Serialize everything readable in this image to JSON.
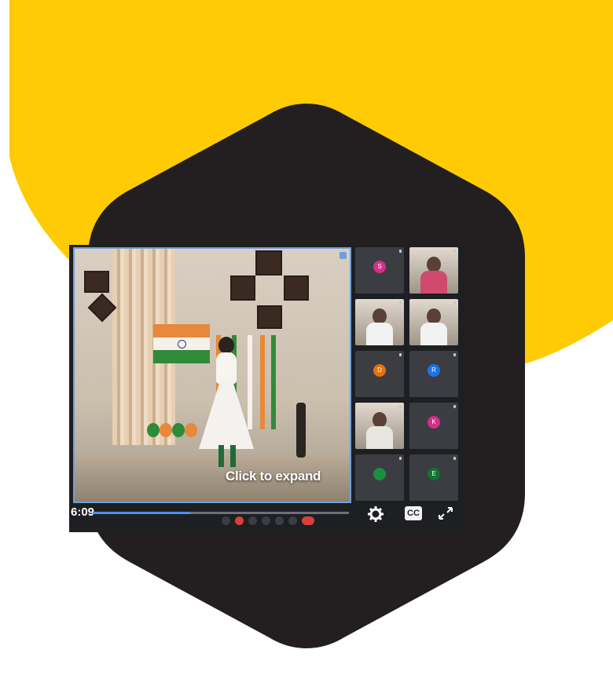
{
  "colors": {
    "background": "#ffffff",
    "yellow_shape": "#fecb05",
    "hexagon": "#231f20",
    "meet_bg": "#1e1f22",
    "tile_bg": "#3c3d42",
    "accent_blue": "#4d8ef0",
    "end_call_red": "#d8413a"
  },
  "main_video": {
    "overlay_label": "Click to expand"
  },
  "player": {
    "time": "6:09",
    "progress_fraction": 0.38
  },
  "toolbar": {
    "buttons": [
      {
        "icon": "hand-icon",
        "style": "normal"
      },
      {
        "icon": "mic-off-icon",
        "style": "red"
      },
      {
        "icon": "camera-icon",
        "style": "normal"
      },
      {
        "icon": "captions-icon",
        "style": "normal"
      },
      {
        "icon": "present-icon",
        "style": "normal"
      },
      {
        "icon": "more-icon",
        "style": "normal"
      },
      {
        "icon": "end-call-icon",
        "style": "end"
      }
    ]
  },
  "participants": [
    {
      "initial": "S",
      "color": "#d3308a",
      "video": false
    },
    {
      "initial": "",
      "color": "#c33a5a",
      "video": true,
      "shirt": "#d04a70"
    },
    {
      "initial": "",
      "color": "#cfc6ba",
      "video": true,
      "shirt": "#f2f2f2"
    },
    {
      "initial": "",
      "color": "#cfc6ba",
      "video": true,
      "shirt": "#f2f2f2"
    },
    {
      "initial": "D",
      "color": "#e8710a",
      "video": false
    },
    {
      "initial": "R",
      "color": "#1a73e8",
      "video": false
    },
    {
      "initial": "",
      "color": "#cfc6ba",
      "video": true,
      "shirt": "#e9e6e0"
    },
    {
      "initial": "K",
      "color": "#d3308a",
      "video": false
    },
    {
      "initial": "",
      "color": "#1e8e3e",
      "video": false
    },
    {
      "initial": "E",
      "color": "#137333",
      "video": false
    }
  ],
  "controls": {
    "settings_icon": "gear-icon",
    "captions_label": "CC",
    "fullscreen_icon": "expand-arrows-icon"
  }
}
